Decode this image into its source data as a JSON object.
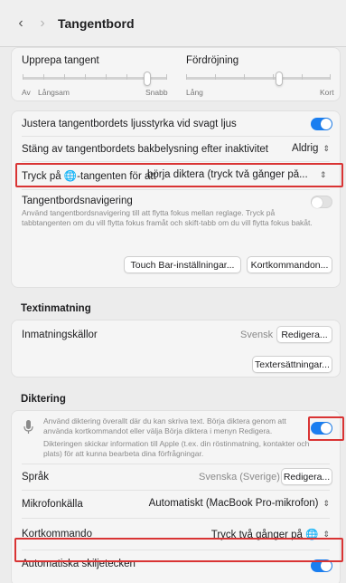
{
  "window": {
    "title": "Tangentbord"
  },
  "keyboard": {
    "repeat_label": "Upprepa tangent",
    "repeat_min": "Av",
    "repeat_slow": "Långsam",
    "repeat_fast": "Snabb",
    "delay_label": "Fördröjning",
    "delay_long": "Lång",
    "delay_short": "Kort",
    "brightness_label": "Justera tangentbordets ljusstyrka vid svagt ljus",
    "brightness_on": true,
    "backlight_label": "Stäng av tangentbordets bakbelysning efter inaktivitet",
    "backlight_value": "Aldrig",
    "globe_label": "Tryck på 🌐-tangenten för att",
    "globe_value": "börja diktera (tryck två gånger på...",
    "nav_label": "Tangentbordsnavigering",
    "nav_desc": "Använd tangentbordsnavigering till att flytta fokus mellan reglage. Tryck på tabbtangenten om du vill flytta fokus framåt och skift-tabb om du vill flytta fokus bakåt.",
    "nav_on": false,
    "touchbar_button": "Touch Bar-inställningar...",
    "shortcuts_button": "Kortkommandon..."
  },
  "text_input": {
    "heading": "Textinmatning",
    "sources_label": "Inmatningskällor",
    "sources_value": "Svensk",
    "edit_button": "Redigera...",
    "replacements_button": "Textersättningar..."
  },
  "dictation": {
    "heading": "Diktering",
    "desc_1": "Använd diktering överallt där du kan skriva text. Börja diktera genom att använda kortkommandot eller välja Börja diktera i menyn Redigera.",
    "desc_2": "Dikteringen skickar information till Apple (t.ex. din röstinmatning, kontakter och plats) för att kunna bearbeta dina förfrågningar.",
    "enabled": true,
    "language_label": "Språk",
    "language_value": "Svenska (Sverige)",
    "language_edit": "Redigera...",
    "mic_label": "Mikrofonkälla",
    "mic_value": "Automatiskt (MacBook Pro-mikrofon)",
    "shortcut_label": "Kortkommando",
    "shortcut_value": "Tryck två gånger på 🌐",
    "punct_label": "Automatiska skiljetecken",
    "punct_on": true
  },
  "colors": {
    "accent": "#1a7ef0",
    "highlight": "#d93434"
  }
}
